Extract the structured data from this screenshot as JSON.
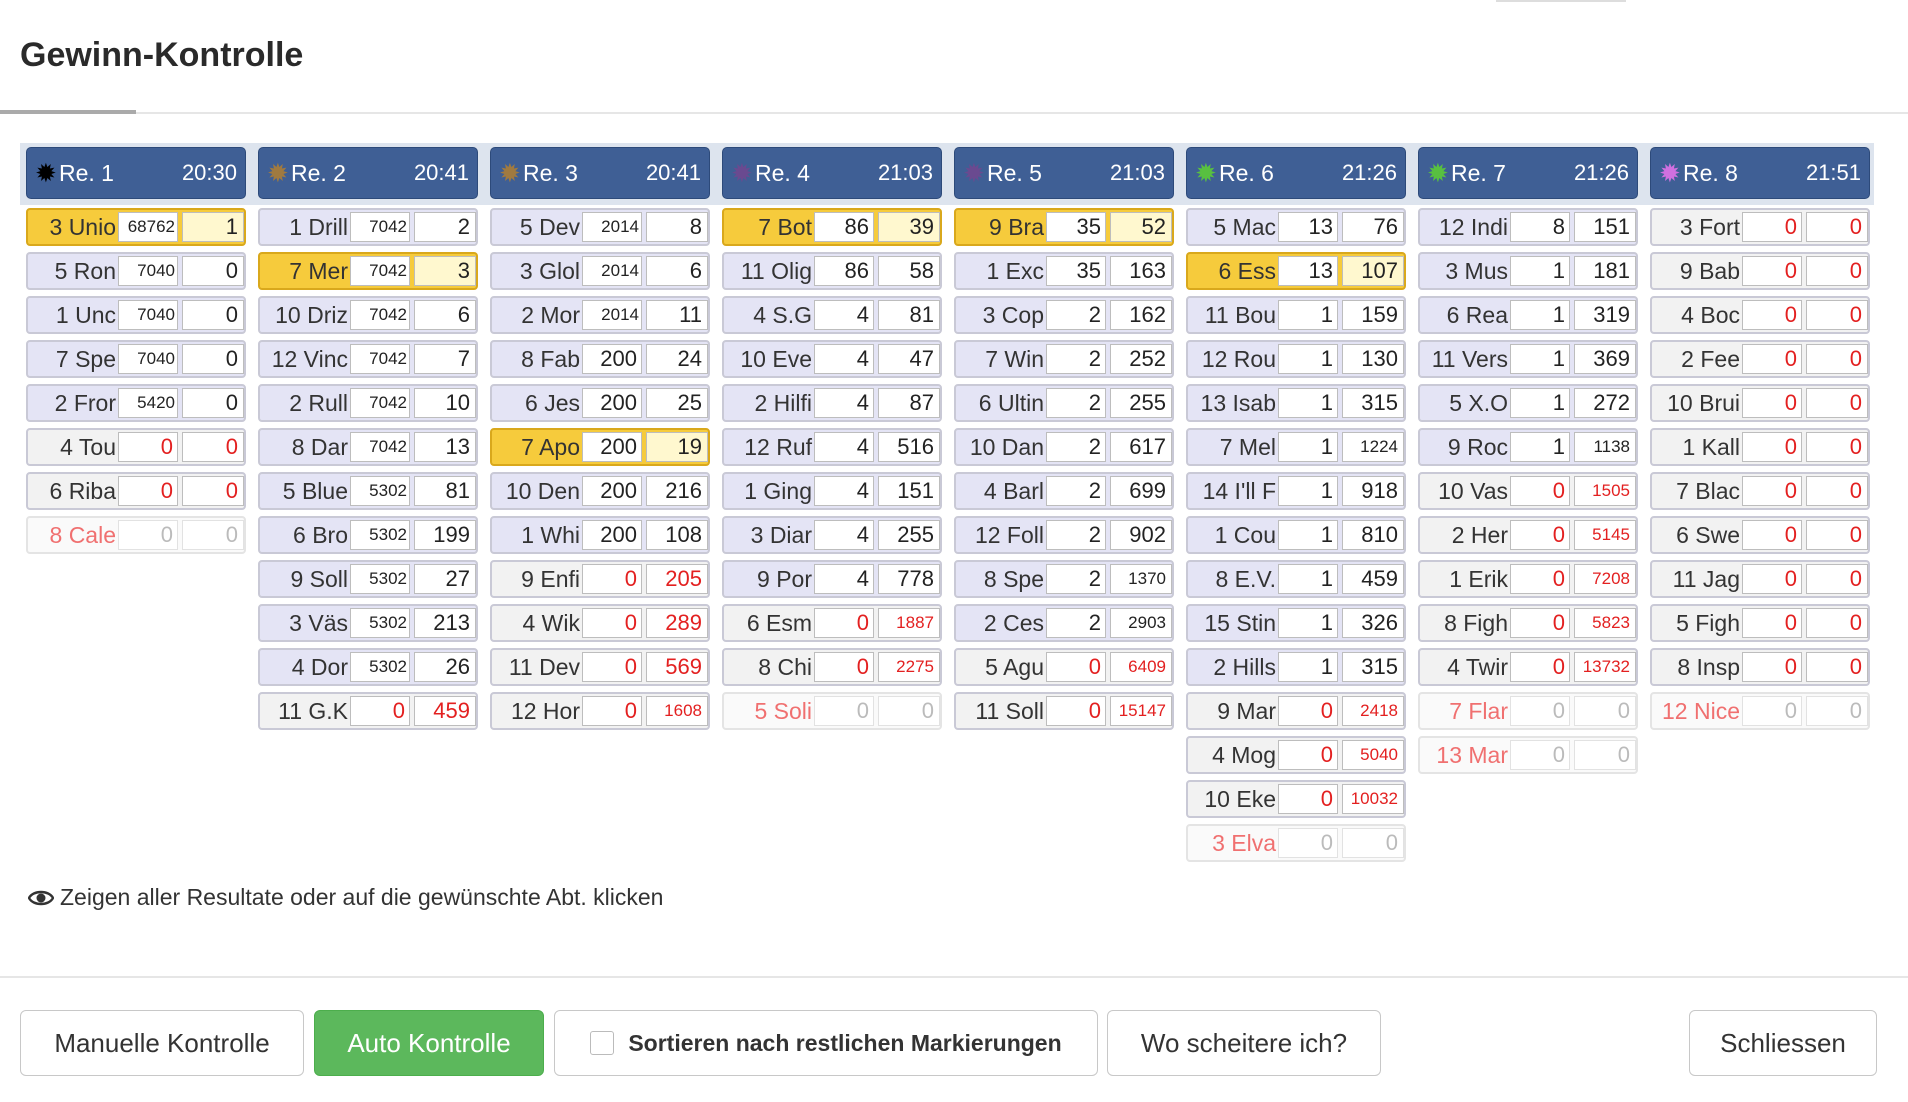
{
  "title": "Gewinn-Kontrolle",
  "hint": "Zeigen aller Resultate oder auf die gewünschte Abt. klicken",
  "buttons": {
    "manual": "Manuelle Kontrolle",
    "auto": "Auto Kontrolle",
    "sort_label": "Sortieren nach restlichen Markierungen",
    "where": "Wo scheitere ich?",
    "close": "Schliessen"
  },
  "colors": {
    "header_blue": "#3f5f95",
    "won_yellow": "#f6cb3c",
    "auto_green": "#5cb85c",
    "loss_red": "#e32020"
  },
  "races": [
    {
      "label": "Re. 1",
      "time": "20:30",
      "star_color": "#000000",
      "rows": [
        [
          "3 Unio",
          68762,
          1,
          "won"
        ],
        [
          "5 Ron",
          7040,
          0,
          ""
        ],
        [
          "1 Unc",
          7040,
          0,
          ""
        ],
        [
          "7 Spe",
          7040,
          0,
          ""
        ],
        [
          "2 Fror",
          5420,
          0,
          ""
        ],
        [
          "4 Tou",
          0,
          0,
          "out"
        ],
        [
          "6 Riba",
          0,
          0,
          "out"
        ],
        [
          "8 Cale",
          0,
          0,
          "scratched"
        ]
      ]
    },
    {
      "label": "Re. 2",
      "time": "20:41",
      "star_color": "#a07a40",
      "rows": [
        [
          "1 Drill",
          7042,
          2,
          ""
        ],
        [
          "7 Mer",
          7042,
          3,
          "won"
        ],
        [
          "10 Driz",
          7042,
          6,
          ""
        ],
        [
          "12 Vinc",
          7042,
          7,
          ""
        ],
        [
          "2 Rull",
          7042,
          10,
          ""
        ],
        [
          "8 Dar",
          7042,
          13,
          ""
        ],
        [
          "5 Blue",
          5302,
          81,
          ""
        ],
        [
          "6 Bro",
          5302,
          199,
          ""
        ],
        [
          "9 Soll",
          5302,
          27,
          ""
        ],
        [
          "3 Väs",
          5302,
          213,
          ""
        ],
        [
          "4 Dor",
          5302,
          26,
          ""
        ],
        [
          "11 G.K",
          0,
          459,
          "out"
        ]
      ]
    },
    {
      "label": "Re. 3",
      "time": "20:41",
      "star_color": "#a07a40",
      "rows": [
        [
          "5 Dev",
          2014,
          8,
          ""
        ],
        [
          "3 Glol",
          2014,
          6,
          ""
        ],
        [
          "2 Mor",
          2014,
          11,
          ""
        ],
        [
          "8 Fab",
          200,
          24,
          ""
        ],
        [
          "6 Jes",
          200,
          25,
          ""
        ],
        [
          "7 Apo",
          200,
          19,
          "won"
        ],
        [
          "10 Den",
          200,
          216,
          ""
        ],
        [
          "1 Whi",
          200,
          108,
          ""
        ],
        [
          "9 Enfi",
          0,
          205,
          "out"
        ],
        [
          "4 Wik",
          0,
          289,
          "out"
        ],
        [
          "11 Dev",
          0,
          569,
          "out"
        ],
        [
          "12 Hor",
          0,
          1608,
          "out"
        ]
      ]
    },
    {
      "label": "Re. 4",
      "time": "21:03",
      "star_color": "#6a4a90",
      "rows": [
        [
          "7 Bot",
          86,
          39,
          "won"
        ],
        [
          "11 Olig",
          86,
          58,
          ""
        ],
        [
          "4 S.G",
          4,
          81,
          ""
        ],
        [
          "10 Eve",
          4,
          47,
          ""
        ],
        [
          "2 Hilfi",
          4,
          87,
          ""
        ],
        [
          "12 Ruf",
          4,
          516,
          ""
        ],
        [
          "1 Ging",
          4,
          151,
          ""
        ],
        [
          "3 Diar",
          4,
          255,
          ""
        ],
        [
          "9 Por",
          4,
          778,
          ""
        ],
        [
          "6 Esm",
          0,
          1887,
          "out"
        ],
        [
          "8 Chi",
          0,
          2275,
          "out"
        ],
        [
          "5 Soli",
          0,
          0,
          "scratched"
        ]
      ]
    },
    {
      "label": "Re. 5",
      "time": "21:03",
      "star_color": "#6a4a90",
      "rows": [
        [
          "9 Bra",
          35,
          52,
          "won"
        ],
        [
          "1 Exc",
          35,
          163,
          ""
        ],
        [
          "3 Cop",
          2,
          162,
          ""
        ],
        [
          "7 Win",
          2,
          252,
          ""
        ],
        [
          "6 Ultin",
          2,
          255,
          ""
        ],
        [
          "10 Dan",
          2,
          617,
          ""
        ],
        [
          "4 Barl",
          2,
          699,
          ""
        ],
        [
          "12 Foll",
          2,
          902,
          ""
        ],
        [
          "8 Spe",
          2,
          1370,
          ""
        ],
        [
          "2 Ces",
          2,
          2903,
          ""
        ],
        [
          "5 Agu",
          0,
          6409,
          "out"
        ],
        [
          "11 Soll",
          0,
          15147,
          "out"
        ]
      ]
    },
    {
      "label": "Re. 6",
      "time": "21:26",
      "star_color": "#58c040",
      "rows": [
        [
          "5 Mac",
          13,
          76,
          ""
        ],
        [
          "6 Ess",
          13,
          107,
          "won"
        ],
        [
          "11 Bou",
          1,
          159,
          ""
        ],
        [
          "12 Rou",
          1,
          130,
          ""
        ],
        [
          "13 Isab",
          1,
          315,
          ""
        ],
        [
          "7 Mel",
          1,
          1224,
          ""
        ],
        [
          "14 I'll F",
          1,
          918,
          ""
        ],
        [
          "1 Cou",
          1,
          810,
          ""
        ],
        [
          "8 E.V.",
          1,
          459,
          ""
        ],
        [
          "15 Stin",
          1,
          326,
          ""
        ],
        [
          "2 Hills",
          1,
          315,
          ""
        ],
        [
          "9 Mar",
          0,
          2418,
          "out"
        ],
        [
          "4 Mog",
          0,
          5040,
          "out"
        ],
        [
          "10 Eke",
          0,
          10032,
          "out"
        ],
        [
          "3 Elva",
          0,
          0,
          "scratched"
        ]
      ]
    },
    {
      "label": "Re. 7",
      "time": "21:26",
      "star_color": "#58c040",
      "rows": [
        [
          "12 Indi",
          8,
          151,
          ""
        ],
        [
          "3 Mus",
          1,
          181,
          ""
        ],
        [
          "6 Rea",
          1,
          319,
          ""
        ],
        [
          "11 Vers",
          1,
          369,
          ""
        ],
        [
          "5 X.O",
          1,
          272,
          ""
        ],
        [
          "9 Roc",
          1,
          1138,
          ""
        ],
        [
          "10 Vas",
          0,
          1505,
          "out"
        ],
        [
          "2 Her",
          0,
          5145,
          "out"
        ],
        [
          "1 Erik",
          0,
          7208,
          "out"
        ],
        [
          "8 Figh",
          0,
          5823,
          "out"
        ],
        [
          "4 Twir",
          0,
          13732,
          "out"
        ],
        [
          "7 Flar",
          0,
          0,
          "scratched"
        ],
        [
          "13 Mar",
          0,
          0,
          "scratched"
        ]
      ]
    },
    {
      "label": "Re. 8",
      "time": "21:51",
      "star_color": "#d070e0",
      "rows": [
        [
          "3 Fort",
          0,
          0,
          "out"
        ],
        [
          "9 Bab",
          0,
          0,
          "out"
        ],
        [
          "4 Boc",
          0,
          0,
          "out"
        ],
        [
          "2 Fee",
          0,
          0,
          "out"
        ],
        [
          "10 Brui",
          0,
          0,
          "out"
        ],
        [
          "1 Kall",
          0,
          0,
          "out"
        ],
        [
          "7 Blac",
          0,
          0,
          "out"
        ],
        [
          "6 Swe",
          0,
          0,
          "out"
        ],
        [
          "11 Jag",
          0,
          0,
          "out"
        ],
        [
          "5 Figh",
          0,
          0,
          "out"
        ],
        [
          "8 Insp",
          0,
          0,
          "out"
        ],
        [
          "12 Nice",
          0,
          0,
          "scratched"
        ]
      ]
    }
  ]
}
